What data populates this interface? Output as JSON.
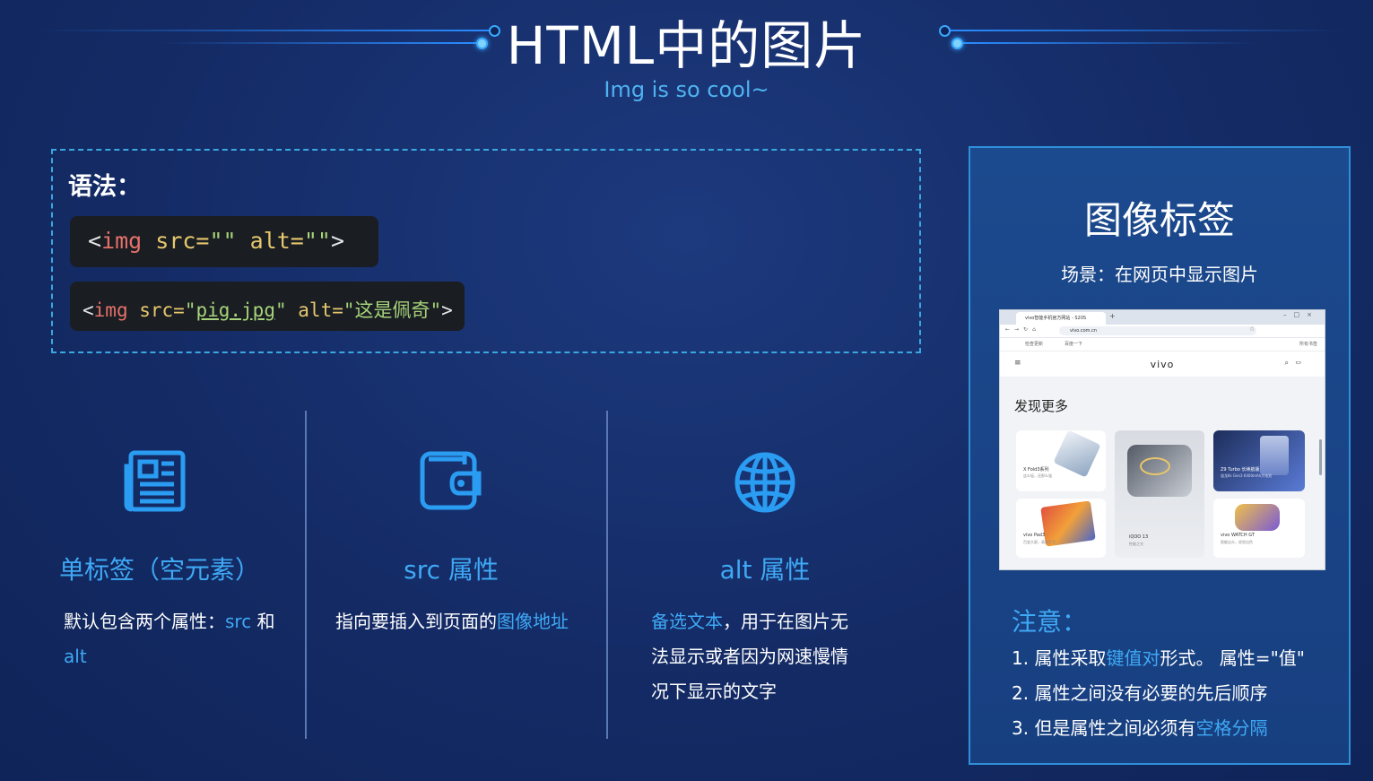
{
  "header": {
    "title": "HTML中的图片",
    "subtitle": "Img is so cool~"
  },
  "syntax": {
    "label": "语法：",
    "code1": {
      "open": "<",
      "tag": "img",
      "attr1": " src=",
      "val1": "\"\"",
      "attr2": " alt=",
      "val2": "\"\"",
      "close": ">"
    },
    "code2": {
      "open": "<",
      "tag": "img",
      "attr1": " src=",
      "q1": "\"",
      "val1": "pig.jpg",
      "q2": "\"",
      "attr2": " alt=",
      "val2": "\"这是佩奇\"",
      "close": ">"
    }
  },
  "columns": [
    {
      "icon": "newspaper-icon",
      "title": "单标签（空元素）",
      "text_a": "默认包含两个属性：",
      "hl1": "src",
      "text_b": " 和 ",
      "hl2": "alt"
    },
    {
      "icon": "wallet-icon",
      "title": "src 属性",
      "text_a": "指向要插入到页面的",
      "hl1": "图像地址"
    },
    {
      "icon": "globe-icon",
      "title": "alt 属性",
      "hl1": "备选文本",
      "text_a": "，用于在图片无",
      "line2": "法显示或者因为网速慢情",
      "line3": "况下显示的文字"
    }
  ],
  "panel": {
    "title": "图像标签",
    "scene": "场景：在网页中显示图片",
    "screenshot": {
      "tab_title": "vivo智能手机官方网站 - S20S",
      "url": "vivo.com.cn",
      "bookmark1": "检查更新",
      "bookmark2": "百度一下",
      "bookmark3": "所有书签",
      "logo": "vivo",
      "heading": "发现更多",
      "cards": [
        {
          "label": "X Fold3系列",
          "sub": "这么轻，还那么强"
        },
        {
          "label": "iQOO 13",
          "sub": "性能之光"
        },
        {
          "label": "Z9 Turbo 长续航版",
          "sub": "骁龙8s Gen3 6400mAh大电池"
        },
        {
          "label": "vivo Pad3",
          "sub": "百变大屏，高效生活"
        },
        {
          "label": "vivo WATCH GT",
          "sub": "智能出众，经验出色"
        }
      ]
    },
    "notes_title": "注意：",
    "notes": [
      {
        "a": "1. 属性采取",
        "hl": "键值对",
        "b": "形式。 属性=\"值\""
      },
      {
        "a": "2. 属性之间没有必要的先后顺序"
      },
      {
        "a": "3. 但是属性之间必须有",
        "hl": "空格分隔"
      }
    ]
  },
  "colors": {
    "background": "#142b66",
    "accent": "#3fa9f5",
    "code_bg": "#1a1d22",
    "dashed_border": "#3aa8e0"
  }
}
